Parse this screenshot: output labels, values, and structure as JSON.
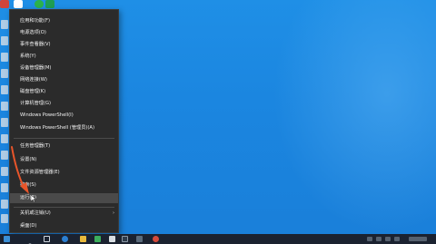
{
  "context_menu": {
    "items": [
      "应用和功能(F)",
      "电源选项(O)",
      "事件查看器(V)",
      "系统(Y)",
      "设备管理器(M)",
      "网络连接(W)",
      "磁盘管理(K)",
      "计算机管理(G)",
      "Windows PowerShell(I)",
      "Windows PowerShell (管理员)(A)",
      "任务管理器(T)",
      "设置(N)",
      "文件资源管理器(E)",
      "搜索(S)",
      "运行(R)",
      "关机或注销(U)",
      "桌面(D)"
    ],
    "highlighted": "运行(R)",
    "submenu_chevron": "›"
  },
  "icons": {
    "search": "search-icon",
    "task_view": "task-view-icon",
    "start": "windows-start-icon"
  },
  "colors": {
    "desktop_blue": "#1b86e0",
    "menu_bg": "#2b2b2b",
    "highlight": "#4a4a4a",
    "arrow": "#e8552a",
    "taskbar": "#1b2230"
  }
}
